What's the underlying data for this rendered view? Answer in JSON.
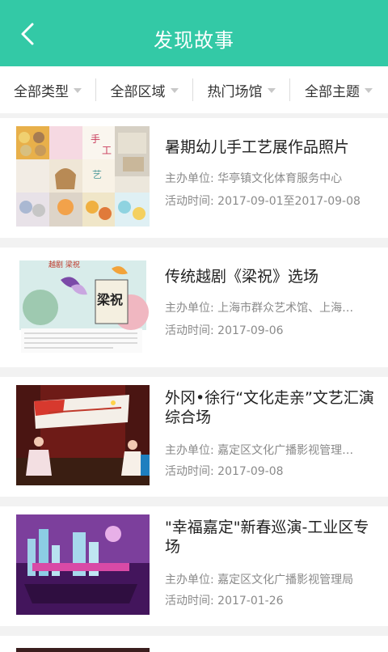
{
  "header": {
    "title": "发现故事"
  },
  "filters": [
    {
      "label": "全部类型"
    },
    {
      "label": "全部区域"
    },
    {
      "label": "热门场馆"
    },
    {
      "label": "全部主题"
    }
  ],
  "list": [
    {
      "title": "暑期幼儿手工艺展作品照片",
      "organizer": "主办单位: 华亭镇文化体育服务中心",
      "time": "活动时间: 2017-09-01至2017-09-08"
    },
    {
      "title": "传统越剧《梁祝》选场",
      "organizer": "主办单位: 上海市群众艺术馆、上海…",
      "time": "活动时间: 2017-09-06",
      "poster_heading": "越剧 梁祝",
      "poster_title": "梁祝"
    },
    {
      "title": "外冈•徐行“文化走亲”文艺汇演综合场",
      "organizer": "主办单位: 嘉定区文化广播影视管理…",
      "time": "活动时间: 2017-09-08"
    },
    {
      "title": "\"幸福嘉定\"新春巡演-工业区专场",
      "organizer": "主办单位: 嘉定区文化广播影视管理局",
      "time": "活动时间: 2017-01-26"
    }
  ],
  "colors": {
    "accent": "#33c9a6"
  }
}
